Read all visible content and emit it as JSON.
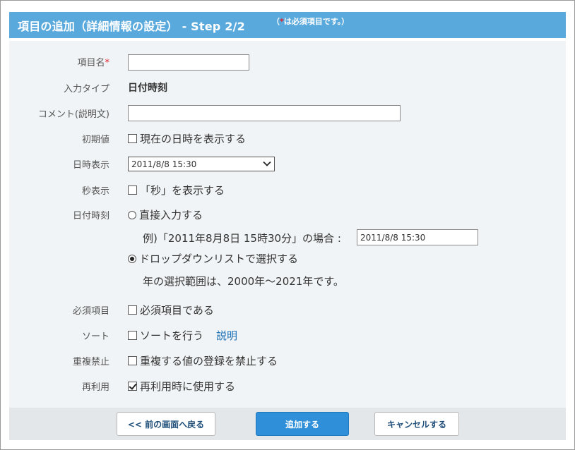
{
  "header": {
    "title": "項目の追加（詳細情報の設定） - Step 2/2",
    "note_open": "（",
    "note_star": "*",
    "note_text": "は必須項目です。）"
  },
  "form": {
    "item_name": {
      "label": "項目名",
      "required_mark": "*",
      "value": ""
    },
    "input_type": {
      "label": "入力タイプ",
      "value": "日付時刻"
    },
    "comment": {
      "label": "コメント(説明文)",
      "value": ""
    },
    "initial_value": {
      "label": "初期値",
      "option": "現在の日時を表示する",
      "checked": false
    },
    "datetime_display": {
      "label": "日時表示",
      "selected": "2011/8/8 15:30"
    },
    "seconds_display": {
      "label": "秒表示",
      "option": "「秒」を表示する",
      "checked": false
    },
    "datetime_input": {
      "label": "日付時刻",
      "option_direct": "直接入力する",
      "example_text": "例)「2011年8月8日 15時30分」の場合 :",
      "example_value": "2011/8/8 15:30",
      "option_dropdown": "ドロップダウンリストで選択する",
      "range_text": "年の選択範囲は、2000年～2021年です。",
      "selected": "dropdown"
    },
    "required": {
      "label": "必須項目",
      "option": "必須項目である",
      "checked": false
    },
    "sort": {
      "label": "ソート",
      "option": "ソートを行う",
      "link": "説明",
      "checked": false
    },
    "no_duplicate": {
      "label": "重複禁止",
      "option": "重複する値の登録を禁止する",
      "checked": false
    },
    "reuse": {
      "label": "再利用",
      "option": "再利用時に使用する",
      "checked": true
    }
  },
  "footer": {
    "back_label": "<< 前の画面へ戻る",
    "add_label": "追加する",
    "cancel_label": "キャンセルする"
  },
  "colors": {
    "header_bg": "#5aa9dc",
    "body_bg": "#f1f4f6",
    "required_star": "#e0202e",
    "primary_button": "#2f8fd8",
    "link": "#1a6fb5"
  }
}
